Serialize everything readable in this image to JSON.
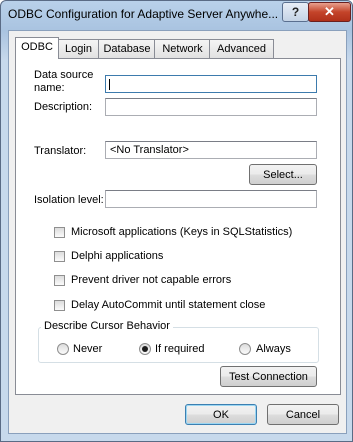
{
  "window": {
    "title": "ODBC Configuration for Adaptive Server Anywhe...",
    "help_label": "?",
    "close_label": "✕"
  },
  "tabs": [
    "ODBC",
    "Login",
    "Database",
    "Network",
    "Advanced"
  ],
  "form": {
    "data_source_label_1": "Data source",
    "data_source_label_2": "name:",
    "data_source_value": "",
    "description_label": "Description:",
    "description_value": "",
    "translator_label": "Translator:",
    "translator_value": "<No Translator>",
    "select_button": "Select...",
    "isolation_label": "Isolation level:",
    "isolation_value": ""
  },
  "options": [
    {
      "label": "Microsoft applications (Keys in SQLStatistics)",
      "checked": false
    },
    {
      "label": "Delphi applications",
      "checked": false
    },
    {
      "label": "Prevent driver not capable errors",
      "checked": false
    },
    {
      "label": "Delay AutoCommit until statement close",
      "checked": false
    }
  ],
  "cursor_group": {
    "title": "Describe Cursor Behavior",
    "options": [
      {
        "label": "Never",
        "selected": false
      },
      {
        "label": "If required",
        "selected": true
      },
      {
        "label": "Always",
        "selected": false
      }
    ]
  },
  "buttons": {
    "test_connection": "Test Connection",
    "ok": "OK",
    "cancel": "Cancel"
  }
}
